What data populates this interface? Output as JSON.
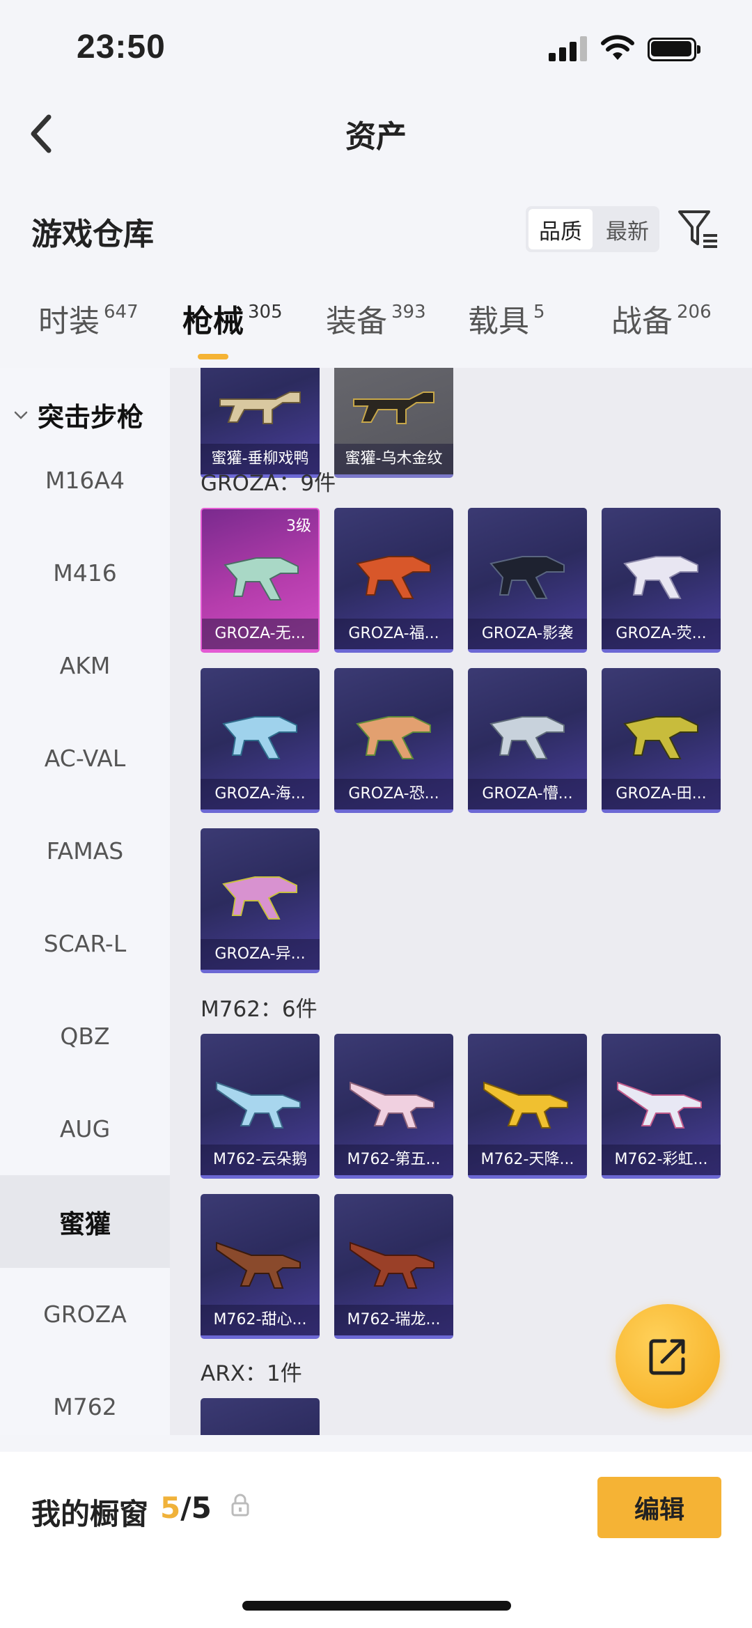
{
  "status_bar": {
    "time": "23:50"
  },
  "nav": {
    "title": "资产"
  },
  "warehouse": {
    "title": "游戏仓库",
    "sort_options": [
      "品质",
      "最新"
    ],
    "active_sort": "品质"
  },
  "tabs": [
    {
      "label": "时装",
      "count": "647"
    },
    {
      "label": "枪械",
      "count": "305",
      "active": true
    },
    {
      "label": "装备",
      "count": "393"
    },
    {
      "label": "载具",
      "count": "5"
    },
    {
      "label": "战备",
      "count": "206"
    }
  ],
  "sidebar": {
    "category": "突击步枪",
    "items": [
      "M16A4",
      "M416",
      "AKM",
      "AC-VAL",
      "FAMAS",
      "SCAR-L",
      "QBZ",
      "AUG",
      "蜜獾",
      "GROZA",
      "M762"
    ],
    "active_item": "蜜獾"
  },
  "groups": [
    {
      "label": "",
      "items": [
        {
          "name": "蜜獾-垂柳戏鸭"
        },
        {
          "name": "蜜獾-乌木金纹"
        }
      ]
    },
    {
      "label": "GROZA：9件",
      "items": [
        {
          "name": "GROZA-无...",
          "level": "3级"
        },
        {
          "name": "GROZA-福..."
        },
        {
          "name": "GROZA-影袭"
        },
        {
          "name": "GROZA-荧..."
        },
        {
          "name": "GROZA-海..."
        },
        {
          "name": "GROZA-恐..."
        },
        {
          "name": "GROZA-懵..."
        },
        {
          "name": "GROZA-田..."
        },
        {
          "name": "GROZA-异..."
        }
      ]
    },
    {
      "label": "M762：6件",
      "items": [
        {
          "name": "M762-云朵鹅"
        },
        {
          "name": "M762-第五..."
        },
        {
          "name": "M762-天降..."
        },
        {
          "name": "M762-彩虹..."
        },
        {
          "name": "M762-甜心..."
        },
        {
          "name": "M762-瑞龙..."
        }
      ]
    },
    {
      "label": "ARX：1件",
      "items": []
    }
  ],
  "bottom": {
    "showcase_label": "我的橱窗",
    "showcase_current": "5",
    "showcase_total": "/5",
    "edit_label": "编辑"
  },
  "colors": {
    "accent": "#f5b335",
    "card_purple": "#3b3a73",
    "card_pink": "#b53dac"
  },
  "icons": [
    "back-arrow-icon",
    "filter-icon",
    "chevron-down-icon",
    "share-icon",
    "lock-icon"
  ]
}
